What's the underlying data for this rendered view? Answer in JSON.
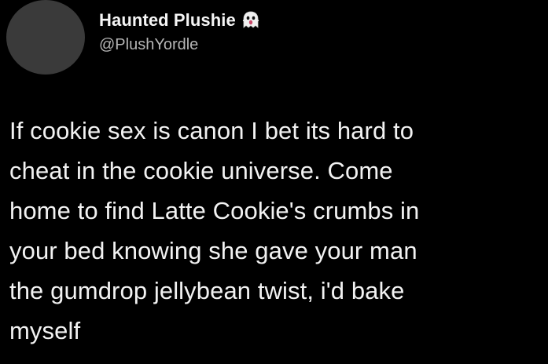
{
  "tweet": {
    "author": {
      "display_name": "Haunted Plushie",
      "handle": "@PlushYordle",
      "badge_icon": "ghost-icon"
    },
    "text": "If cookie sex is canon I bet its hard to\ncheat in the cookie universe. Come\nhome to find Latte Cookie's crumbs in\nyour bed knowing she gave your man\nthe gumdrop jellybean twist, i'd bake\nmyself"
  },
  "colors": {
    "background": "#000000",
    "text_primary": "#f2f2f2",
    "text_secondary": "#b5b5b5",
    "avatar_placeholder": "#3a3a3a"
  }
}
